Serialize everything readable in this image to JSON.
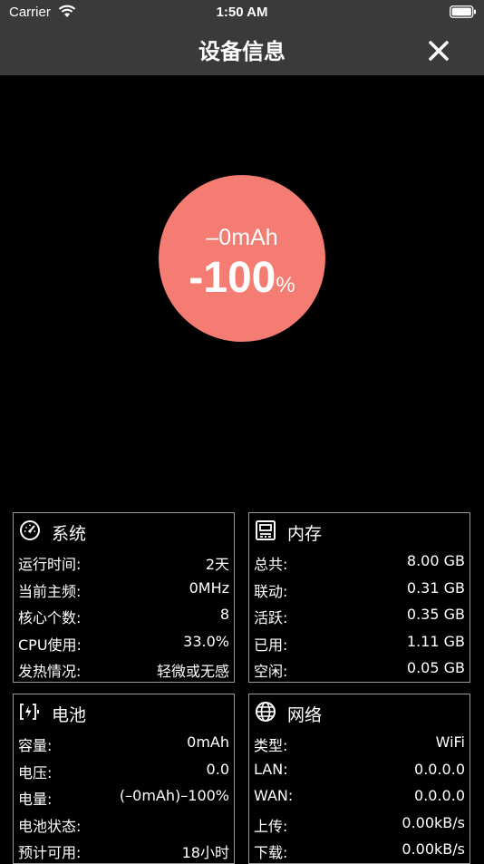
{
  "status": {
    "carrier": "Carrier",
    "time": "1:50 AM"
  },
  "nav": {
    "title": "设备信息"
  },
  "battery_display": {
    "capacity": "–0mAh",
    "percent": "-100",
    "percent_unit": "%",
    "circle_color": "#f47c72"
  },
  "cards": {
    "system": {
      "title": "系统",
      "rows": [
        {
          "label": "运行时间:",
          "value": "2天"
        },
        {
          "label": "当前主频:",
          "value": "0MHz"
        },
        {
          "label": "核心个数:",
          "value": "8"
        },
        {
          "label": "CPU使用:",
          "value": "33.0%"
        },
        {
          "label": "发热情况:",
          "value": "轻微或无感"
        }
      ]
    },
    "memory": {
      "title": "内存",
      "rows": [
        {
          "label": "总共:",
          "value": "8.00 GB"
        },
        {
          "label": "联动:",
          "value": "0.31 GB"
        },
        {
          "label": "活跃:",
          "value": "0.35 GB"
        },
        {
          "label": "已用:",
          "value": "1.11 GB"
        },
        {
          "label": "空闲:",
          "value": "0.05 GB"
        }
      ]
    },
    "battery": {
      "title": "电池",
      "rows": [
        {
          "label": "容量:",
          "value": "0mAh"
        },
        {
          "label": "电压:",
          "value": "0.0"
        },
        {
          "label": "电量:",
          "value": "(–0mAh)–100%"
        },
        {
          "label": "电池状态:",
          "value": ""
        },
        {
          "label": "预计可用:",
          "value": "18小时"
        }
      ]
    },
    "network": {
      "title": "网络",
      "rows": [
        {
          "label": "类型:",
          "value": "WiFi"
        },
        {
          "label": "LAN:",
          "value": "0.0.0.0"
        },
        {
          "label": "WAN:",
          "value": "0.0.0.0"
        },
        {
          "label": "上传:",
          "value": "0.00kB/s"
        },
        {
          "label": "下载:",
          "value": "0.00kB/s"
        }
      ]
    }
  }
}
